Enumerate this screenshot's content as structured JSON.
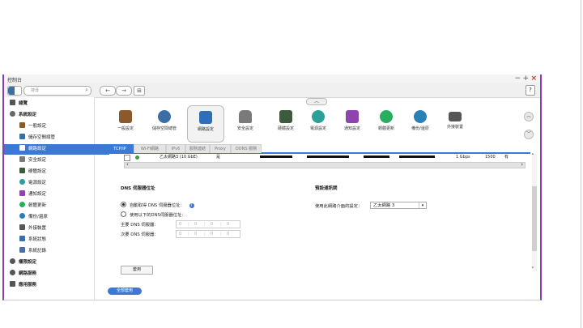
{
  "window": {
    "title": "控制台"
  },
  "toolbar": {
    "search_placeholder": "搜尋",
    "back": "←",
    "forward": "→",
    "grid": "⊞",
    "help": "?"
  },
  "window_controls": {
    "minimize": "−",
    "maximize": "+",
    "close": "×"
  },
  "sidebar": {
    "items": [
      {
        "label": "總覽",
        "level": 0
      },
      {
        "label": "系統設定",
        "level": 0
      },
      {
        "label": "一般設定",
        "level": 2
      },
      {
        "label": "儲存空間總管",
        "level": 2
      },
      {
        "label": "網路設定",
        "level": 2,
        "selected": true
      },
      {
        "label": "安全設定",
        "level": 2
      },
      {
        "label": "硬體設定",
        "level": 2
      },
      {
        "label": "電源設定",
        "level": 2
      },
      {
        "label": "通知設定",
        "level": 2
      },
      {
        "label": "韌體更新",
        "level": 2
      },
      {
        "label": "備份/還原",
        "level": 2
      },
      {
        "label": "外接裝置",
        "level": 2
      },
      {
        "label": "系統狀態",
        "level": 2
      },
      {
        "label": "系統記錄",
        "level": 2
      },
      {
        "label": "權限設定",
        "level": 0
      },
      {
        "label": "網路服務",
        "level": 0
      },
      {
        "label": "應用服務",
        "level": 0
      }
    ]
  },
  "top_icons": [
    {
      "label": "一般設定",
      "color": "#8a5a2b"
    },
    {
      "label": "儲存空間總管",
      "color": "#3a6ea5"
    },
    {
      "label": "網路設定",
      "color": "#2f6fb8",
      "active": true
    },
    {
      "label": "安全設定",
      "color": "#7a7a7a"
    },
    {
      "label": "硬體設定",
      "color": "#3d5a3d"
    },
    {
      "label": "電源設定",
      "color": "#2aa198"
    },
    {
      "label": "通知設定",
      "color": "#8e44ad"
    },
    {
      "label": "韌體更新",
      "color": "#27ae60"
    },
    {
      "label": "備份/還原",
      "color": "#2980b9"
    },
    {
      "label": "外接裝置",
      "color": "#555555"
    }
  ],
  "tabs": [
    "TCP/IP",
    "Wi-Fi網路",
    "IPv6",
    "服務連結",
    "Proxy",
    "DDNS 服務"
  ],
  "adapter_row": {
    "name": "乙太網路3 (10 GbE)",
    "status": "是",
    "speed": "1 Gbps",
    "mtu": "1500",
    "extra": "有"
  },
  "dns": {
    "title": "DNS 伺服器位址",
    "auto_label": "自動取得 DNS 伺服器位址：",
    "manual_label": "使用以下的DNS伺服器位址：",
    "primary_label": "主要 DNS 伺服器：",
    "secondary_label": "次要 DNS 伺服器：",
    "ip_primary": [
      "0",
      "0",
      "0",
      "0"
    ],
    "ip_secondary": [
      "0",
      "0",
      "0",
      "0"
    ]
  },
  "gateway": {
    "title": "預設通訊閘",
    "label": "使用此網路介面的設定：",
    "value": "乙太網路 3"
  },
  "buttons": {
    "apply": "套用",
    "apply_all": "全部套用"
  }
}
